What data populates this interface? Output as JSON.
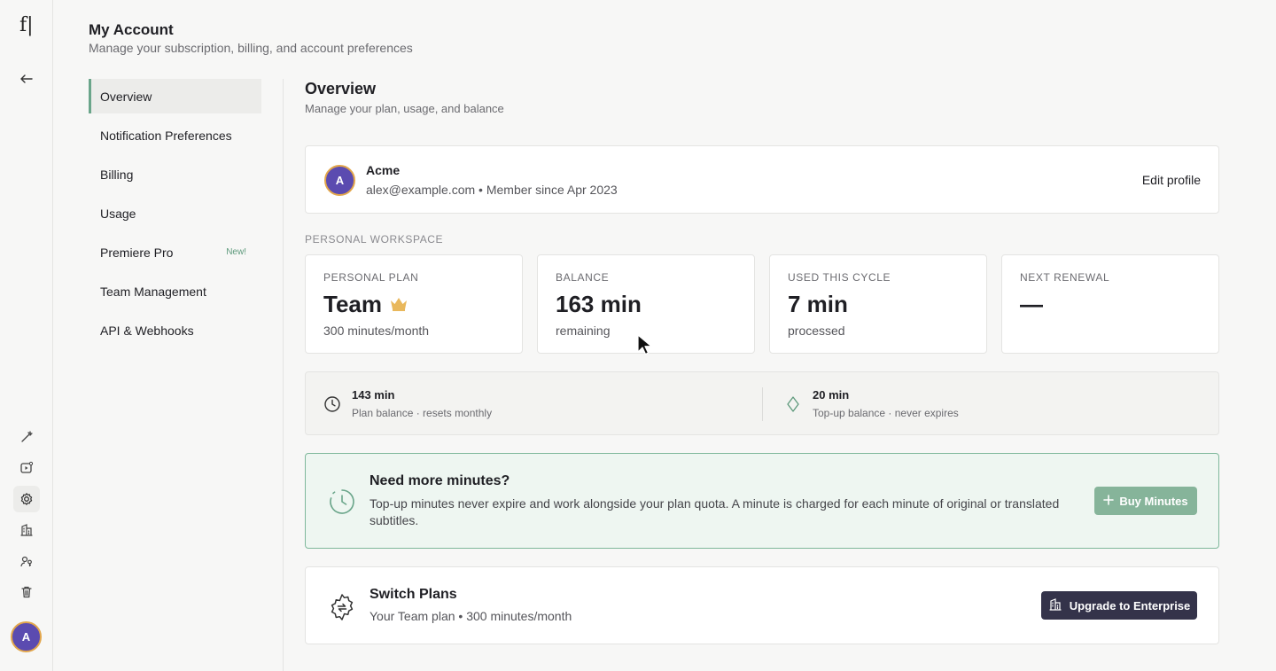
{
  "app": {
    "logo": "f|",
    "user_initial": "A"
  },
  "rail": {
    "icons": [
      "back-arrow-icon",
      "wand-icon",
      "video-icon",
      "settings-icon",
      "building-icon",
      "users-key-icon",
      "trash-icon"
    ]
  },
  "header": {
    "title": "My Account",
    "subtitle": "Manage your subscription, billing, and account preferences"
  },
  "nav": {
    "items": [
      {
        "label": "Overview",
        "active": true
      },
      {
        "label": "Notification Preferences"
      },
      {
        "label": "Billing"
      },
      {
        "label": "Usage"
      },
      {
        "label": "Premiere Pro",
        "badge": "New!"
      },
      {
        "label": "Team Management"
      },
      {
        "label": "API & Webhooks"
      }
    ]
  },
  "overview": {
    "title": "Overview",
    "subtitle": "Manage your plan, usage, and balance"
  },
  "profile": {
    "initial": "A",
    "name": "Acme",
    "meta": "alex@example.com • Member since Apr 2023",
    "edit_label": "Edit profile"
  },
  "workspace": {
    "label": "PERSONAL WORKSPACE",
    "stats": [
      {
        "label": "PERSONAL PLAN",
        "value": "Team",
        "sub": "300 minutes/month",
        "icon": "crown-icon"
      },
      {
        "label": "BALANCE",
        "value": "163 min",
        "sub": "remaining"
      },
      {
        "label": "USED THIS CYCLE",
        "value": "7 min",
        "sub": "processed"
      },
      {
        "label": "NEXT RENEWAL",
        "value": "—",
        "sub": ""
      }
    ]
  },
  "balances": [
    {
      "value": "143 min",
      "sub": "Plan balance · resets monthly",
      "icon": "clock-icon"
    },
    {
      "value": "20 min",
      "sub": "Top-up balance · never expires",
      "icon": "diamond-icon"
    }
  ],
  "promo": {
    "title": "Need more minutes?",
    "text": "Top-up minutes never expire and work alongside your plan quota. A minute is charged for each minute of original or translated subtitles.",
    "button": "Buy Minutes",
    "accent": "#86b49a"
  },
  "switch_plans": {
    "title": "Switch Plans",
    "subtitle": "Your Team plan • 300 minutes/month",
    "button": "Upgrade to Enterprise"
  }
}
